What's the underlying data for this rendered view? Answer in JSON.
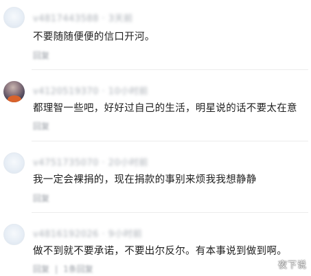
{
  "comments": [
    {
      "meta": "v4817443588 · 3天前",
      "text": "不要随随便便的信口开河。",
      "reply_label": "回复"
    },
    {
      "meta": "v4120519370 · 10小时前",
      "text": "都理智一些吧，好好过自己的生活，明星说的话不要太在意",
      "reply_label": "回复"
    },
    {
      "meta": "v4751735070 · 20小时前",
      "text": "我一定会裸捐的，现在捐款的事别来烦我我想静静",
      "reply_label": "回复"
    },
    {
      "meta": "v4816192026 · 9小时前",
      "text": "做不到就不要承诺，不要出尔反尔。有本事说到做到啊。",
      "reply_label": "回复",
      "replies_label": "1条回复"
    }
  ],
  "watermark": "夜下说"
}
